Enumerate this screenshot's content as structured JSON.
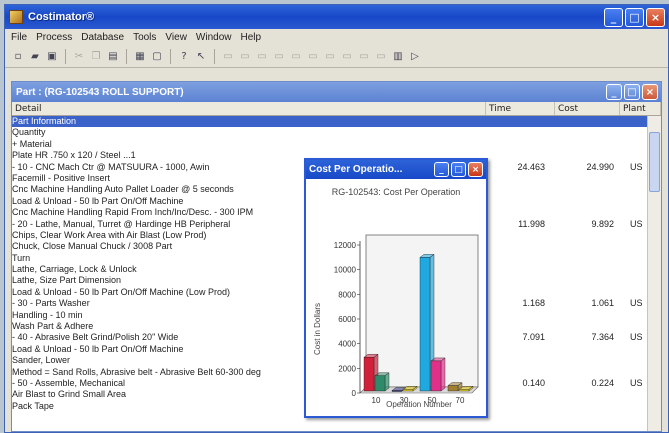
{
  "app": {
    "title": "Costimator®",
    "menu": [
      "File",
      "Process",
      "Database",
      "Tools",
      "View",
      "Window",
      "Help"
    ],
    "window_buttons": [
      "_",
      "□",
      "×"
    ]
  },
  "toolbar_icons": [
    "new-icon",
    "open-icon",
    "save-icon",
    "cut-icon",
    "copy-icon",
    "paste-icon",
    "print-icon",
    "preview-icon",
    "help-icon",
    "whats-this-icon",
    "dim1-icon",
    "dim2-icon",
    "dim3-icon",
    "dim4-icon",
    "dim5-icon",
    "printer-icon",
    "run-icon"
  ],
  "child": {
    "title": "Part : (RG-102543 ROLL SUPPORT)",
    "columns": {
      "detail": "Detail",
      "time": "Time",
      "cost": "Cost",
      "plant": "Plant"
    },
    "rows": [
      {
        "detail": "Part Information",
        "time": "",
        "cost": "",
        "plant": "",
        "selected": true
      },
      {
        "detail": "   Quantity",
        "time": "",
        "cost": "",
        "plant": ""
      },
      {
        "detail": "  + Material",
        "time": "",
        "cost": "",
        "plant": ""
      },
      {
        "detail": "       Plate HR  .750 x 120 / Steel ...1",
        "time": "",
        "cost": "",
        "plant": ""
      },
      {
        "detail": "  - 10 - CNC Mach Ctr @ MATSUURA - 1000, Awin",
        "time": "24.463",
        "cost": "24.990",
        "plant": "US"
      },
      {
        "detail": "       Facemill - Positive Insert",
        "time": "",
        "cost": "",
        "plant": ""
      },
      {
        "detail": "       Cnc Machine Handling Auto Pallet Loader  @  5 seconds",
        "time": "",
        "cost": "",
        "plant": ""
      },
      {
        "detail": "       Load & Unload - 50 lb Part On/Off Machine",
        "time": "",
        "cost": "",
        "plant": ""
      },
      {
        "detail": "       Cnc Machine Handling Rapid From Inch/Inc/Desc. - 300 IPM",
        "time": "",
        "cost": "",
        "plant": ""
      },
      {
        "detail": "  - 20 - Lathe, Manual, Turret @ Hardinge HB Peripheral",
        "time": "11.998",
        "cost": "9.892",
        "plant": "US"
      },
      {
        "detail": "       Chips, Clear Work Area with Air Blast (Low Prod)",
        "time": "",
        "cost": "",
        "plant": ""
      },
      {
        "detail": "       Chuck, Close Manual Chuck / 3008 Part",
        "time": "",
        "cost": "",
        "plant": ""
      },
      {
        "detail": "       Turn",
        "time": "",
        "cost": "",
        "plant": ""
      },
      {
        "detail": "       Lathe, Carriage, Lock & Unlock",
        "time": "",
        "cost": "",
        "plant": ""
      },
      {
        "detail": "       Lathe, Size Part Dimension",
        "time": "",
        "cost": "",
        "plant": ""
      },
      {
        "detail": "       Load & Unload - 50 lb Part On/Off Machine (Low Prod)",
        "time": "",
        "cost": "",
        "plant": ""
      },
      {
        "detail": "  - 30 - Parts Washer",
        "time": "1.168",
        "cost": "1.061",
        "plant": "US"
      },
      {
        "detail": "       Handling - 10 min",
        "time": "",
        "cost": "",
        "plant": ""
      },
      {
        "detail": "       Wash Part & Adhere",
        "time": "",
        "cost": "",
        "plant": ""
      },
      {
        "detail": "  - 40 - Abrasive Belt Grind/Polish 20\" Wide",
        "time": "7.091",
        "cost": "7.364",
        "plant": "US"
      },
      {
        "detail": "       Load & Unload - 50 lb Part On/Off Machine",
        "time": "",
        "cost": "",
        "plant": ""
      },
      {
        "detail": "       Sander, Lower",
        "time": "",
        "cost": "",
        "plant": ""
      },
      {
        "detail": "       Method = Sand Rolls, Abrasive belt - Abrasive Belt 60-300 deg",
        "time": "",
        "cost": "",
        "plant": ""
      },
      {
        "detail": "  - 50 - Assemble, Mechanical",
        "time": "0.140",
        "cost": "0.224",
        "plant": "US"
      },
      {
        "detail": "       Air Blast to Grind Small Area",
        "time": "",
        "cost": "",
        "plant": ""
      },
      {
        "detail": "       Pack Tape",
        "time": "",
        "cost": "",
        "plant": ""
      }
    ]
  },
  "popup": {
    "title": "Cost Per Operatio...",
    "icon": "chart-icon"
  },
  "chart_data": {
    "type": "bar",
    "title": "RG-102543: Cost Per Operation",
    "xlabel": "Operation Number",
    "ylabel": "Cost in Dollars",
    "categories": [
      "10",
      "30",
      "50",
      "70"
    ],
    "ylim": [
      0,
      12000
    ],
    "yticks": [
      0,
      2000,
      4000,
      6000,
      8000,
      10000,
      12000
    ],
    "bars": [
      {
        "category": "10",
        "value": 2900,
        "color": "#d0203a"
      },
      {
        "category": "10",
        "value": 1400,
        "color": "#2e8a68"
      },
      {
        "category": "30",
        "value": 200,
        "color": "#404090"
      },
      {
        "category": "30",
        "value": 300,
        "color": "#e8d020"
      },
      {
        "category": "50",
        "value": 11000,
        "color": "#20a8e0"
      },
      {
        "category": "50",
        "value": 2600,
        "color": "#e0308a"
      },
      {
        "category": "70",
        "value": 600,
        "color": "#a08030"
      },
      {
        "category": "70",
        "value": 300,
        "color": "#e8d020"
      }
    ]
  }
}
